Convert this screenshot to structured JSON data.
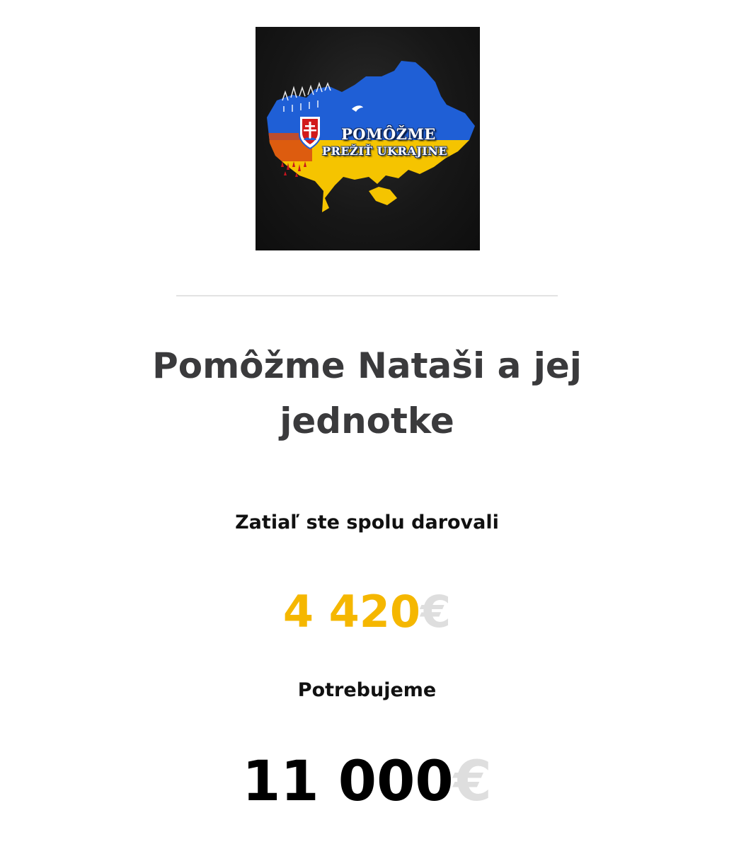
{
  "logo": {
    "line1": "POMÔŽME",
    "line2": "PREŽIŤ UKRAJINE",
    "icon": "ukraine-map-slovakia-emblem",
    "colors": {
      "background": "#141414",
      "blue": "#1f5fd6",
      "yellow": "#f5c400",
      "red": "#d21a1a"
    }
  },
  "campaign": {
    "title": "Pomôžme Nataši a jej jednotke"
  },
  "donated": {
    "label": "Zatiaľ ste spolu darovali",
    "amount": "4 420",
    "currency": "€",
    "color": "#f5b700"
  },
  "needed": {
    "label": "Potrebujeme",
    "amount": "11 000",
    "currency": "€",
    "color": "#000000"
  }
}
